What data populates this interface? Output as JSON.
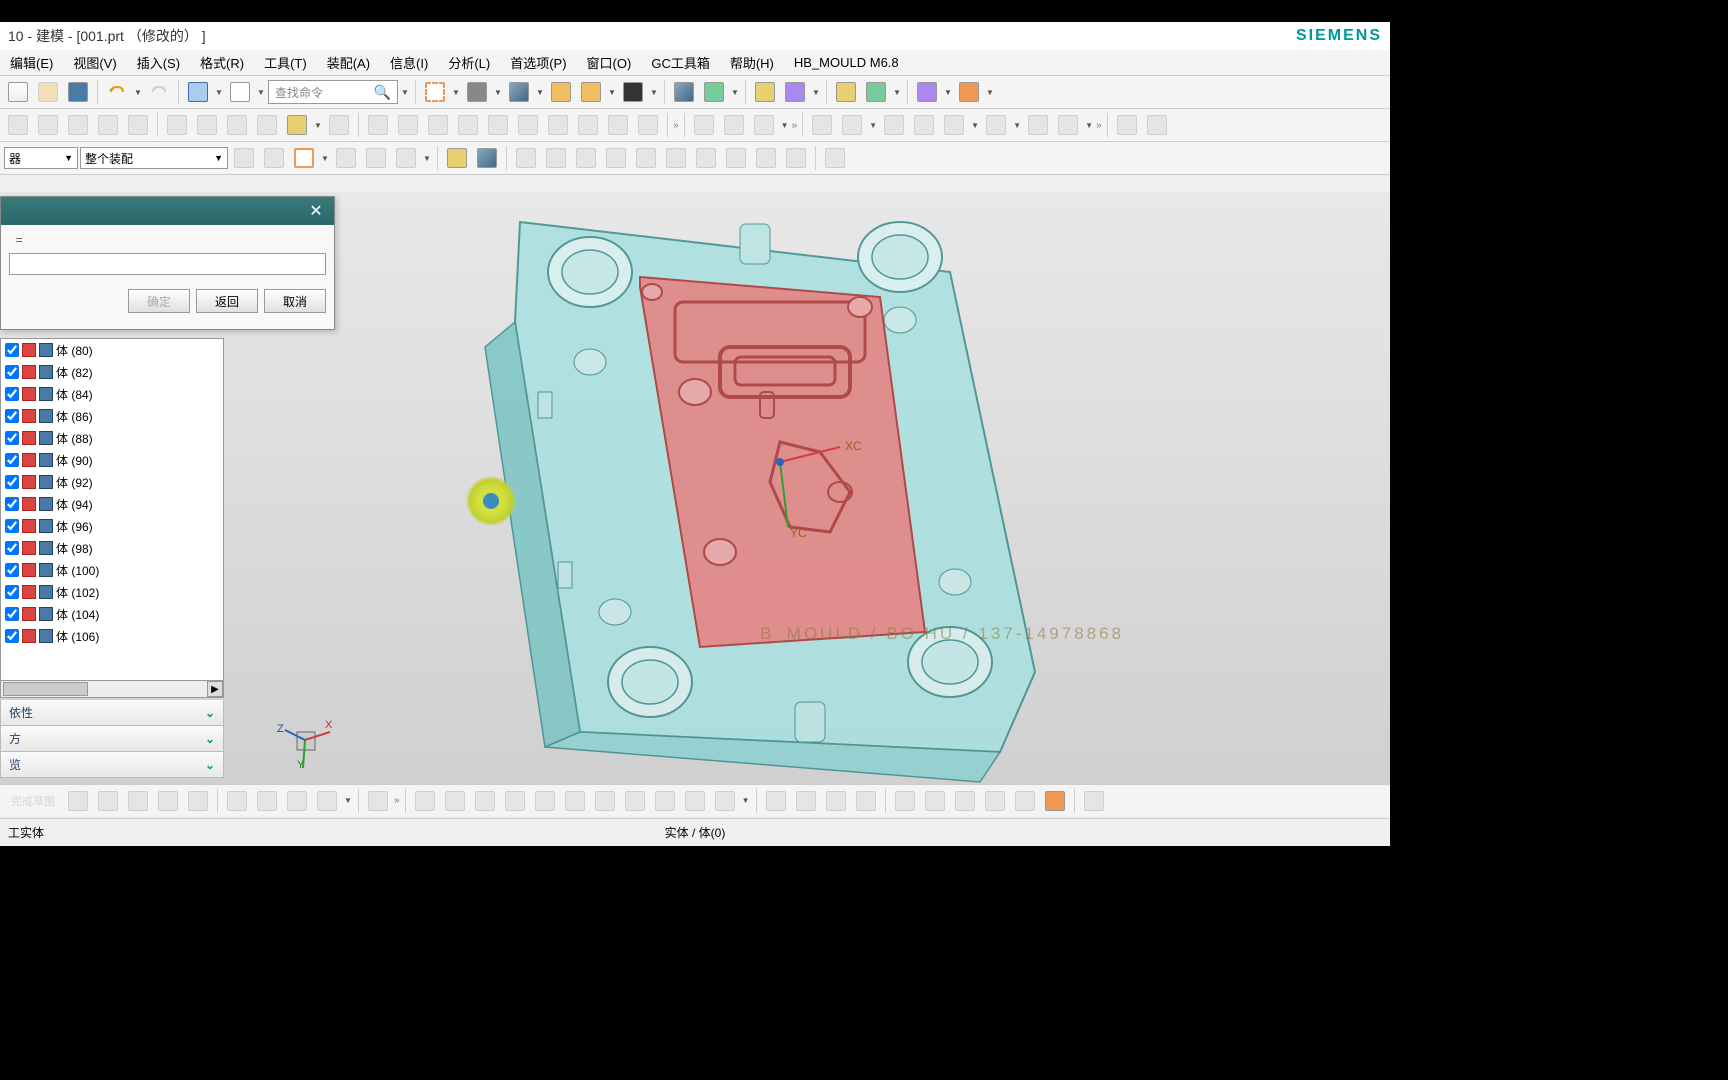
{
  "title": "10 - 建模 - [001.prt  （修改的）  ]",
  "brand": "SIEMENS",
  "menus": [
    "编辑(E)",
    "视图(V)",
    "插入(S)",
    "格式(R)",
    "工具(T)",
    "装配(A)",
    "信息(I)",
    "分析(L)",
    "首选项(P)",
    "窗口(O)",
    "GC工具箱",
    "帮助(H)",
    "HB_MOULD M6.8"
  ],
  "search": {
    "placeholder": "查找命令"
  },
  "combo1": "器",
  "combo2": "整个装配",
  "dialog": {
    "filter_eq": "=",
    "btn_ok": "确定",
    "btn_back": "返回",
    "btn_cancel": "取消"
  },
  "tree_items": [
    "体 (80)",
    "体 (82)",
    "体 (84)",
    "体 (86)",
    "体 (88)",
    "体 (90)",
    "体 (92)",
    "体 (94)",
    "体 (96)",
    "体 (98)",
    "体 (100)",
    "体 (102)",
    "体 (104)",
    "体 (106)"
  ],
  "panel_sections": [
    "依性",
    "方",
    "览"
  ],
  "watermark": "B_MOULD  /  BO.HU  /  137-14978868",
  "axes": {
    "x": "X",
    "y": "Y",
    "z": "Z",
    "xc": "XC",
    "yc": "YC"
  },
  "status_left": "工实体",
  "status_center": "实体 / 体(0)",
  "spinner_label": "完成草图"
}
